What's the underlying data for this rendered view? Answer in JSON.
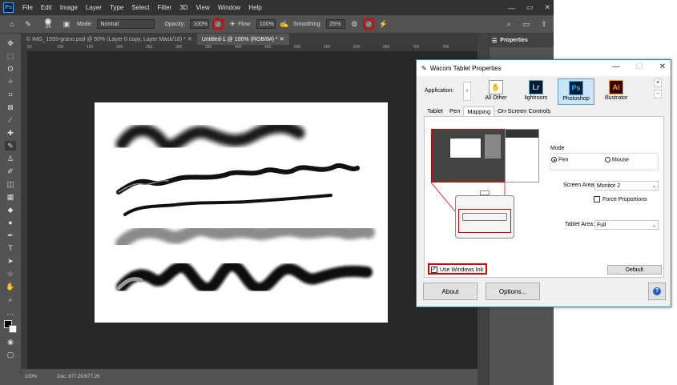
{
  "menubar": {
    "logo": "Ps",
    "items": [
      "File",
      "Edit",
      "Image",
      "Layer",
      "Type",
      "Select",
      "Filter",
      "3D",
      "View",
      "Window",
      "Help"
    ]
  },
  "options": {
    "brush_size": "34",
    "mode_label": "Mode:",
    "mode_value": "Normal",
    "opacity_label": "Opacity:",
    "opacity_value": "100%",
    "flow_label": "Flow:",
    "flow_value": "100%",
    "smoothing_label": "Smoothing:",
    "smoothing_value": "25%"
  },
  "tabs": [
    {
      "label": "© IMG_1593-grano.psd @ 50% (Layer 0 copy, Layer Mask/16) *"
    },
    {
      "label": "Untitled-1 @ 100% (RGB/8#) *"
    }
  ],
  "ruler_ticks": [
    "50",
    "100",
    "150",
    "200",
    "250",
    "300",
    "350",
    "400",
    "450",
    "500",
    "550",
    "600",
    "650",
    "700",
    "750"
  ],
  "status": {
    "zoom": "100%",
    "doc": "Doc: 877.2K/877.2K"
  },
  "right_panel": {
    "title": "Properties"
  },
  "wacom": {
    "title": "Wacom Tablet Properties",
    "application_label": "Application:",
    "apps": [
      {
        "label": "All Other",
        "icon": "AO"
      },
      {
        "label": "lightroom",
        "icon": "Lr"
      },
      {
        "label": "Photoshop",
        "icon": "Ps"
      },
      {
        "label": "Illustrator",
        "icon": "Ai"
      }
    ],
    "tabs": [
      "Tablet",
      "Pen",
      "Mapping",
      "On-Screen Controls"
    ],
    "mode_label": "Mode",
    "mode_pen": "Pen",
    "mode_mouse": "Mouse",
    "screen_area_label": "Screen Area:",
    "screen_area_value": "Monitor 2",
    "force_proportions": "Force Proportions",
    "tablet_area_label": "Tablet Area:",
    "tablet_area_value": "Full",
    "use_windows_ink": "Use Windows Ink",
    "default_btn": "Default",
    "about_btn": "About",
    "options_btn": "Options...",
    "help_btn": "?"
  },
  "colors": {
    "accent_red": "#e00000",
    "ps_blue": "#31a8ff",
    "dialog_border": "#1883d7"
  }
}
